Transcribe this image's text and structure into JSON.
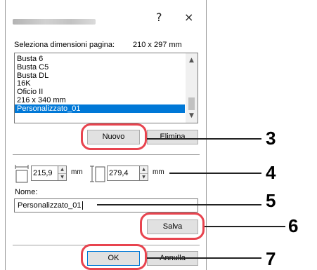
{
  "titlebar": {
    "help_label": "?",
    "close_label": "×"
  },
  "page_size": {
    "label": "Seleziona dimensioni pagina:",
    "dimensions": "210 x 297 mm",
    "items": [
      "Busta 6",
      "Busta C5",
      "Busta DL",
      "16K",
      "Oficio II",
      "216 x 340 mm",
      "Personalizzato_01"
    ],
    "selected_index": 6
  },
  "buttons": {
    "new_label": "Nuovo",
    "delete_label": "Elimina",
    "save_label": "Salva",
    "ok_label": "OK",
    "cancel_label": "Annulla"
  },
  "size_fields": {
    "width_value": "215,9",
    "width_unit": "mm",
    "height_value": "279,4",
    "height_unit": "mm"
  },
  "name_field": {
    "label": "Nome:",
    "value": "Personalizzato_01"
  },
  "callouts": [
    "3",
    "4",
    "5",
    "6",
    "7"
  ],
  "colors": {
    "selection": "#0078d7",
    "highlight": "#e8444f"
  }
}
